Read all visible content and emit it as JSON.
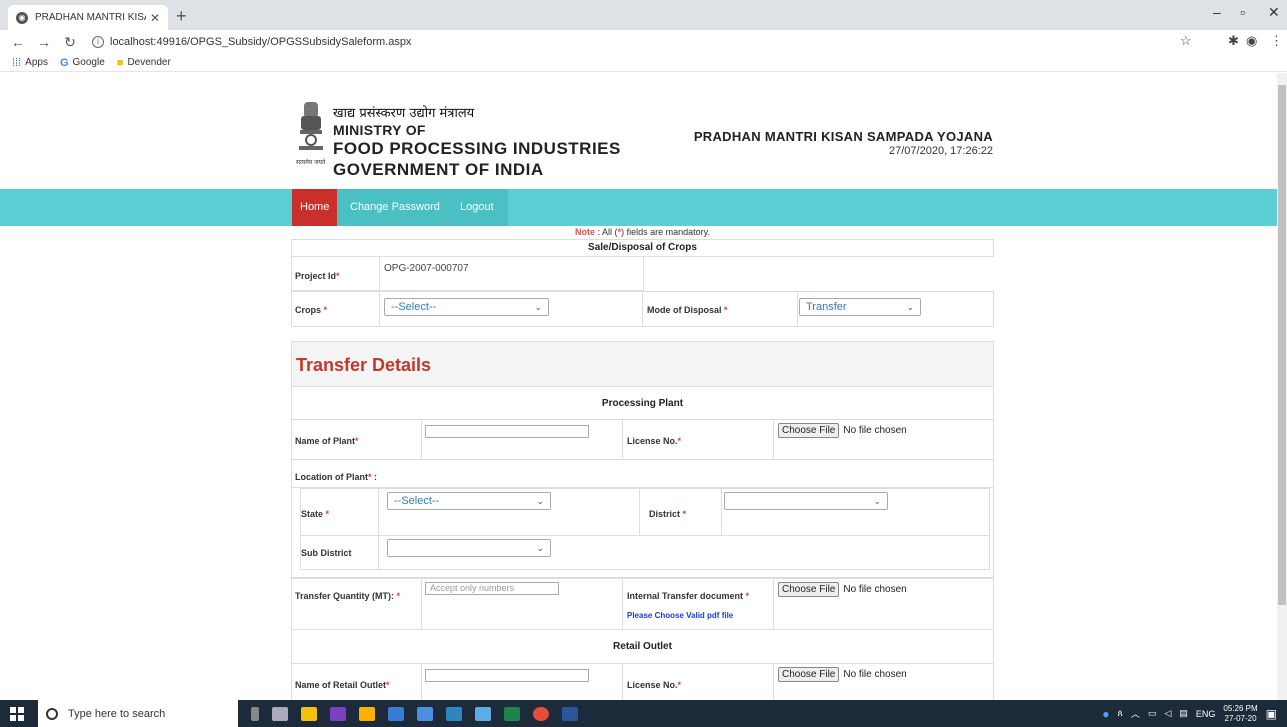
{
  "browser": {
    "tab_title": "PRADHAN MANTRI KISAN SAMP",
    "url": "localhost:49916/OPGS_Subsidy/OPGSSubsidySaleform.aspx",
    "bookmarks": [
      {
        "label": "Apps",
        "icon": "apps-grid-icon"
      },
      {
        "label": "Google",
        "icon": "google-icon"
      },
      {
        "label": "Devender",
        "icon": "folder-icon"
      }
    ]
  },
  "header": {
    "hindi": "खाद्य प्रसंस्करण उद्योग मंत्रालय",
    "ministry_line1": "MINISTRY OF",
    "ministry_line2": "FOOD PROCESSING INDUSTRIES",
    "ministry_line3": "GOVERNMENT OF INDIA",
    "motto": "सत्यमेव जयते",
    "scheme_title": "PRADHAN MANTRI KISAN SAMPADA YOJANA",
    "datetime": "27/07/2020, 17:26:22"
  },
  "nav": {
    "home": "Home",
    "change_password": "Change Password",
    "logout": "Logout"
  },
  "form": {
    "note_prefix": "Note",
    "note_text": " : All (",
    "note_star": "*",
    "note_suffix": ") fields are mandatory.",
    "title": "Sale/Disposal of Crops",
    "project_id_label": "Project Id",
    "project_id_value": "OPG-2007-000707",
    "crops_label": "Crops ",
    "crops_value": "--Select--",
    "mode_label": "Mode of Disposal ",
    "mode_value": "Transfer",
    "transfer_heading": "Transfer Details",
    "processing_plant_title": "Processing Plant",
    "name_of_plant_label": "Name of Plant",
    "license_label": "License No.",
    "choose_file": "Choose File",
    "no_file": "No file chosen",
    "location_label": "Location of Plant",
    "location_suffix": " :",
    "state_label": "State ",
    "state_value": "--Select--",
    "district_label": "District ",
    "sub_district_label": "Sub District",
    "transfer_qty_label": "Transfer Quantity (MT): ",
    "transfer_qty_placeholder": "Accept only numbers",
    "internal_doc_label": "Internal Transfer document ",
    "valid_pdf_hint": "Please Choose Valid pdf file",
    "retail_outlet_title": "Retail Outlet",
    "name_of_retail_label": "Name of Retail Outlet",
    "req_star": "*"
  },
  "taskbar": {
    "search_placeholder": "Type here to search",
    "lang": "ENG",
    "time": "05:26 PM",
    "date": "27-07-20"
  }
}
